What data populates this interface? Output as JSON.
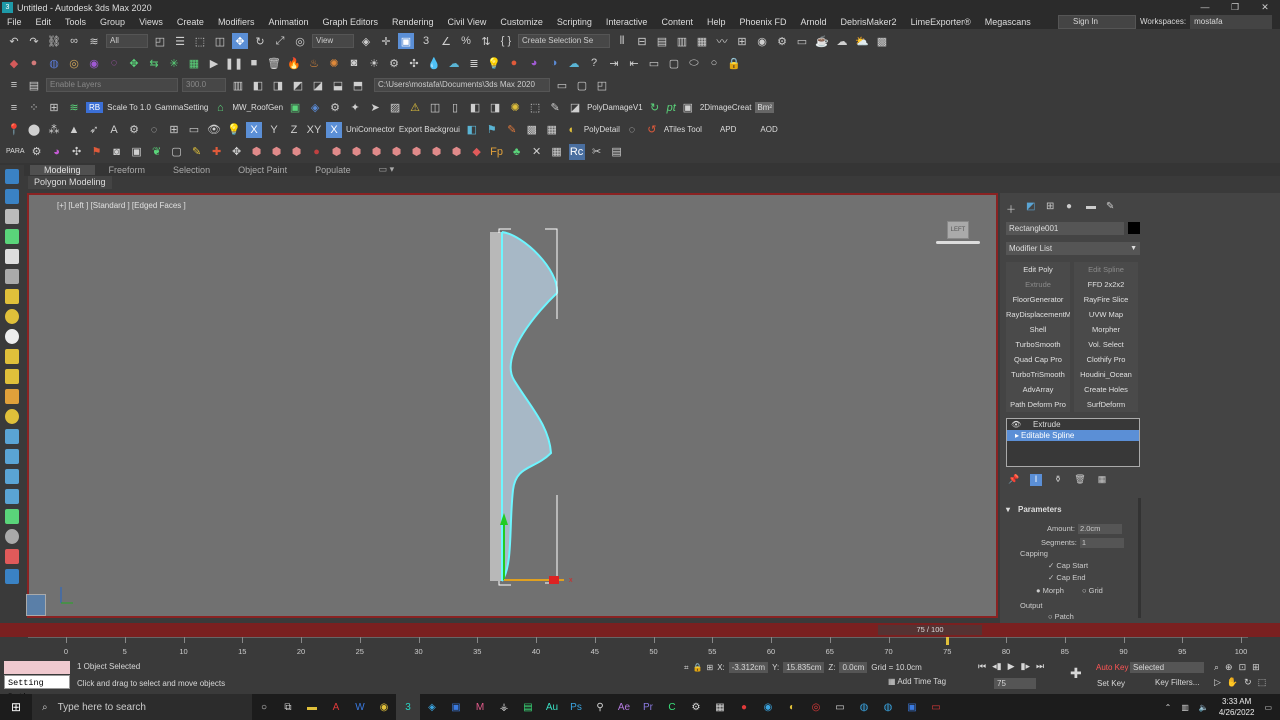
{
  "window": {
    "title": "Untitled - Autodesk 3ds Max 2020",
    "controls": [
      "—",
      "❐",
      "✕"
    ]
  },
  "menu": [
    "File",
    "Edit",
    "Tools",
    "Group",
    "Views",
    "Create",
    "Modifiers",
    "Animation",
    "Graph Editors",
    "Rendering",
    "Civil View",
    "Customize",
    "Scripting",
    "Interactive",
    "Content",
    "Help",
    "Phoenix FD",
    "Arnold",
    "DebrisMaker2",
    "LimeExporter®",
    "Megascans"
  ],
  "account": {
    "signin": "Sign In",
    "workspace_label": "Workspaces:",
    "workspace_value": "mostafa"
  },
  "toolbar1": {
    "selection_filter": "All",
    "ref_coord": "View",
    "named_selection": "Create Selection Se"
  },
  "toolbar3": {
    "layers": "Enable Layers",
    "spinner": "300.0",
    "path": "C:\\Users\\mostafa\\Documents\\3ds Max 2020"
  },
  "toolbar4": {
    "rb": "RB",
    "scale": "Scale To 1.0",
    "gamma": "GammaSetting",
    "roofgen": "MW_RoofGen",
    "polydamage": "PolyDamageV1",
    "pt": "pt",
    "imagecreator": "2DimageCreat",
    "bmp": "Bm²"
  },
  "toolbar5": {
    "uniconnector": "UniConnector",
    "export": "Export Backgroui",
    "polydetail": "PolyDetail",
    "atiles": "ATiles Tool",
    "apd": "APD",
    "aod": "AOD"
  },
  "toolbar6": {
    "para": "PARA"
  },
  "ribbon": {
    "tabs": [
      "Modeling",
      "Freeform",
      "Selection",
      "Object Paint",
      "Populate"
    ],
    "active_subtab": "Polygon Modeling"
  },
  "viewport": {
    "label": "[+] [Left ] [Standard ] [Edged Faces ]",
    "cube_label": "LEFT"
  },
  "command_panel": {
    "object_name": "Rectangle001",
    "modifier_list": "Modifier List",
    "modifier_buttons": [
      {
        "label": "Edit Poly",
        "enabled": true
      },
      {
        "label": "Edit Spline",
        "enabled": false
      },
      {
        "label": "Extrude",
        "enabled": false
      },
      {
        "label": "FFD 2x2x2",
        "enabled": true
      },
      {
        "label": "FloorGenerator",
        "enabled": true
      },
      {
        "label": "RayFire Slice",
        "enabled": true
      },
      {
        "label": "RayDisplacementMo",
        "enabled": true
      },
      {
        "label": "UVW Map",
        "enabled": true
      },
      {
        "label": "Shell",
        "enabled": true
      },
      {
        "label": "Morpher",
        "enabled": true
      },
      {
        "label": "TurboSmooth",
        "enabled": true
      },
      {
        "label": "Vol. Select",
        "enabled": true
      },
      {
        "label": "Quad Cap Pro",
        "enabled": true
      },
      {
        "label": "Clothify Pro",
        "enabled": true
      },
      {
        "label": "TurboTriSmooth",
        "enabled": true
      },
      {
        "label": "Houdini_Ocean",
        "enabled": true
      },
      {
        "label": "AdvArray",
        "enabled": true
      },
      {
        "label": "Create Holes",
        "enabled": true
      },
      {
        "label": "Path Deform Pro",
        "enabled": true
      },
      {
        "label": "SurfDeform",
        "enabled": true
      }
    ],
    "stack": [
      "Extrude",
      "Editable Spline"
    ],
    "parameters": {
      "title": "Parameters",
      "amount_label": "Amount:",
      "amount": "2.0cm",
      "segments_label": "Segments:",
      "segments": "1",
      "capping": "Capping",
      "cap_start": "Cap Start",
      "cap_end": "Cap End",
      "morph": "Morph",
      "grid": "Grid",
      "output": "Output",
      "patch": "Patch"
    }
  },
  "timeline": {
    "slider": "75 / 100",
    "ticks": [
      "0",
      "5",
      "10",
      "15",
      "20",
      "25",
      "30",
      "35",
      "40",
      "45",
      "50",
      "55",
      "60",
      "65",
      "70",
      "75",
      "80",
      "85",
      "90",
      "95",
      "100"
    ]
  },
  "status": {
    "selected": "1 Object Selected",
    "hint": "Click and drag to select and move objects",
    "setting_path": "Setting Path",
    "x": "-3.312cm",
    "y": "15.835cm",
    "z": "0.0cm",
    "grid": "Grid = 10.0cm",
    "add_time_tag": "Add Time Tag",
    "frame": "75",
    "auto_key": "Auto Key",
    "set_key": "Set Key",
    "selected_dd": "Selected",
    "key_filters": "Key Filters..."
  },
  "taskbar": {
    "search": "Type here to search",
    "time": "3:33 AM",
    "date": "4/26/2022"
  }
}
